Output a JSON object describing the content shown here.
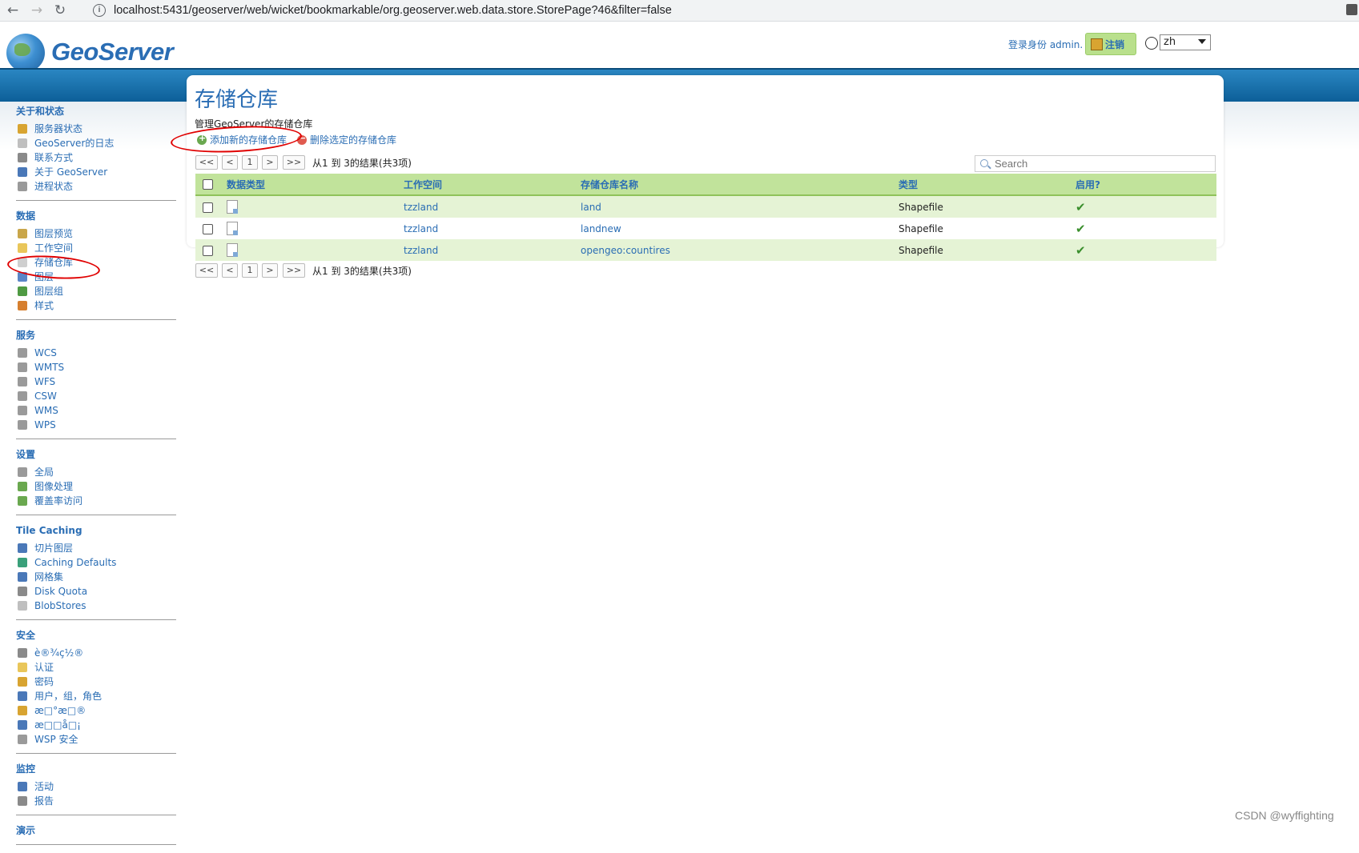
{
  "browser": {
    "url": "localhost:5431/geoserver/web/wicket/bookmarkable/org.geoserver.web.data.store.StorePage?46&filter=false"
  },
  "header": {
    "logo_text": "GeoServer",
    "login_label": "登录身份 admin.",
    "logout_label": "注销",
    "language": "zh"
  },
  "sidebar": {
    "sections": [
      {
        "title": "关于和状态",
        "items": [
          {
            "label": "服务器状态",
            "icon": "server-status-icon",
            "color": "#d8a431"
          },
          {
            "label": "GeoServer的日志",
            "icon": "log-icon",
            "color": "#bfbfbf"
          },
          {
            "label": "联系方式",
            "icon": "contact-icon",
            "color": "#8a8a8a"
          },
          {
            "label": "关于 GeoServer",
            "icon": "about-icon",
            "color": "#4a78b8"
          },
          {
            "label": "进程状态",
            "icon": "process-gear-icon",
            "color": "#9a9a9a"
          }
        ]
      },
      {
        "title": "数据",
        "items": [
          {
            "label": "图层预览",
            "icon": "layer-preview-icon",
            "color": "#c9a64a"
          },
          {
            "label": "工作空间",
            "icon": "workspace-folder-icon",
            "color": "#e9c65a"
          },
          {
            "label": "存储仓库",
            "icon": "store-icon",
            "color": "#cfcfcf"
          },
          {
            "label": "图层",
            "icon": "layer-icon",
            "color": "#5b86c7"
          },
          {
            "label": "图层组",
            "icon": "layer-group-icon",
            "color": "#4f9a43"
          },
          {
            "label": "样式",
            "icon": "style-icon",
            "color": "#d67f2f"
          }
        ]
      },
      {
        "title": "服务",
        "items": [
          {
            "label": "WCS",
            "icon": "wcs-icon",
            "color": "#9a9a9a"
          },
          {
            "label": "WMTS",
            "icon": "wmts-icon",
            "color": "#9a9a9a"
          },
          {
            "label": "WFS",
            "icon": "wfs-icon",
            "color": "#9a9a9a"
          },
          {
            "label": "CSW",
            "icon": "csw-icon",
            "color": "#9a9a9a"
          },
          {
            "label": "WMS",
            "icon": "wms-icon",
            "color": "#9a9a9a"
          },
          {
            "label": "WPS",
            "icon": "wps-icon",
            "color": "#9a9a9a"
          }
        ]
      },
      {
        "title": "设置",
        "items": [
          {
            "label": "全局",
            "icon": "global-settings-icon",
            "color": "#9a9a9a"
          },
          {
            "label": "图像处理",
            "icon": "image-processing-icon",
            "color": "#6aa84f"
          },
          {
            "label": "覆盖率访问",
            "icon": "coverage-access-icon",
            "color": "#6aa84f"
          }
        ]
      },
      {
        "title": "Tile Caching",
        "items": [
          {
            "label": "切片图层",
            "icon": "tile-layers-icon",
            "color": "#4a78b8"
          },
          {
            "label": "Caching Defaults",
            "icon": "caching-defaults-icon",
            "color": "#3aa07a"
          },
          {
            "label": "网格集",
            "icon": "gridsets-icon",
            "color": "#4a78b8"
          },
          {
            "label": "Disk Quota",
            "icon": "disk-quota-icon",
            "color": "#8a8a8a"
          },
          {
            "label": "BlobStores",
            "icon": "blobstores-icon",
            "color": "#bfbfbf"
          }
        ]
      },
      {
        "title": "安全",
        "items": [
          {
            "label": "è®¾ç½®",
            "icon": "wrench-icon",
            "color": "#8a8a8a"
          },
          {
            "label": "认证",
            "icon": "shield-icon",
            "color": "#e9c65a"
          },
          {
            "label": "密码",
            "icon": "lock-icon",
            "color": "#d8a431"
          },
          {
            "label": "用户，组，角色",
            "icon": "users-icon",
            "color": "#4a78b8"
          },
          {
            "label": "æ□°æ□®",
            "icon": "data-security-icon",
            "color": "#d8a431"
          },
          {
            "label": "æ□□å□¡",
            "icon": "service-security-icon",
            "color": "#4a78b8"
          },
          {
            "label": "WSP 安全",
            "icon": "wps-security-icon",
            "color": "#9a9a9a"
          }
        ]
      },
      {
        "title": "监控",
        "items": [
          {
            "label": "活动",
            "icon": "activity-chart-icon",
            "color": "#4a78b8"
          },
          {
            "label": "报告",
            "icon": "report-icon",
            "color": "#8a8a8a"
          }
        ]
      },
      {
        "title": "演示",
        "items": []
      }
    ]
  },
  "page": {
    "title": "存储仓库",
    "description": "管理GeoServer的存储仓库",
    "add_label": "添加新的存储仓库",
    "delete_label": "删除选定的存储仓库",
    "search_placeholder": "Search",
    "pager": {
      "first": "<<",
      "prev": "<",
      "page": "1",
      "next": ">",
      "last": ">>",
      "info": "从1 到 3的结果(共3项)"
    },
    "columns": [
      "数据类型",
      "工作空间",
      "存储仓库名称",
      "类型",
      "启用?"
    ],
    "rows": [
      {
        "workspace": "tzzland",
        "name": "land",
        "type": "Shapefile",
        "enabled": true
      },
      {
        "workspace": "tzzland",
        "name": "landnew",
        "type": "Shapefile",
        "enabled": true
      },
      {
        "workspace": "tzzland",
        "name": "opengeo:countires",
        "type": "Shapefile",
        "enabled": true
      }
    ]
  },
  "watermark": "CSDN @wyffighting",
  "colors": {
    "accent": "#2a6db4",
    "band": "#1b6fa8",
    "table_header": "#c1e39b",
    "table_row_alt": "#e5f3d5",
    "annotation": "#e00000"
  }
}
